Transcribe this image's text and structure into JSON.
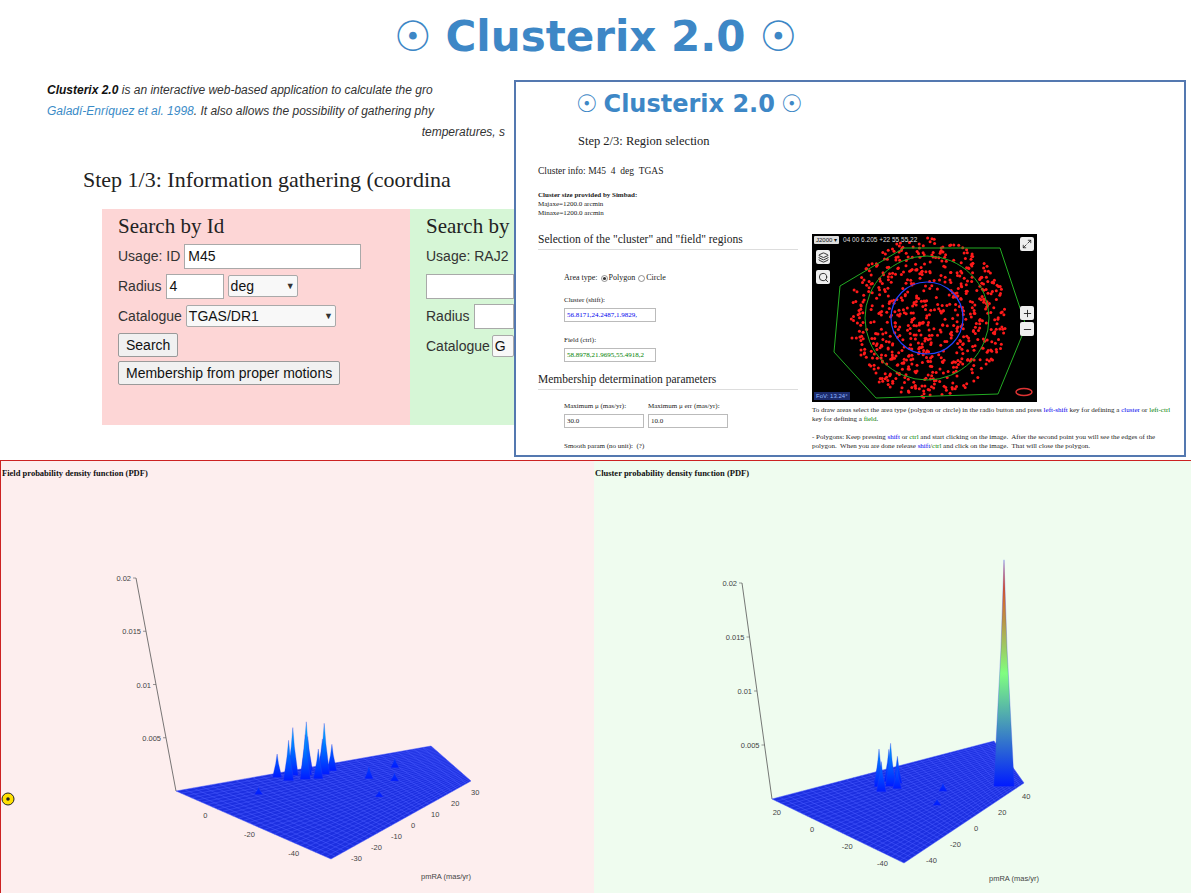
{
  "page": {
    "symbol": "☉",
    "title": "Clusterix 2.0",
    "intro": [
      [
        {
          "text": "Clusterix 2.0",
          "kind": "bold"
        },
        {
          "text": " is an interactive web-based application to calculate the gro",
          "kind": "plain"
        }
      ],
      [
        {
          "text": "Galadí-Enríquez et al. 1998",
          "kind": "link"
        },
        {
          "text": ". It also allows the possibility of gathering phy",
          "kind": "plain"
        }
      ],
      [
        {
          "text": "temperatures, s",
          "kind": "plain"
        }
      ]
    ],
    "step": "Step 1/3: Information gathering (coordina",
    "search_by_id": {
      "title": "Search by Id",
      "usage_label": "Usage: ID",
      "id_value": "M45",
      "radius_label": "Radius",
      "radius_value": "4",
      "unit": "deg",
      "catalogue_label": "Catalogue",
      "catalogue": "TGAS/DR1",
      "arrow": "▼",
      "search_button": "Search",
      "membership_button": "Membership from proper motions"
    },
    "search_by_coordinates": {
      "title": "Search by",
      "usage_label": "Usage: RAJ2",
      "radius_label": "Radius",
      "catalogue_label": "Catalogue",
      "catalogue": "G"
    }
  },
  "region_window": {
    "symbol": "☉",
    "title": "Clusterix 2.0",
    "step": "Step 2/3: Region selection",
    "cluster_info": "Cluster info: M45  4  deg  TGAS",
    "size_heading": "Cluster size provided by Simbad:",
    "size_lines": [
      "Majaxe=1200.0 arcmin",
      "Minaxe=1200.0 arcmin"
    ],
    "selection_heading": "Selection of the \"cluster\" and \"field\" regions",
    "area_type_label": "Area type:",
    "area_types": [
      {
        "label": "Polygon",
        "selected": true
      },
      {
        "label": "Circle",
        "selected": false
      }
    ],
    "cluster_label": "Cluster (shift):",
    "cluster_value": "56.8171,24.2487,1.9829,",
    "field_label": "Field (ctrl):",
    "field_value": "58.8978,21.9695,55.4918,2",
    "membership_heading": "Membership determination parameters",
    "params": [
      {
        "label": "Maximum μ (mas/yr):",
        "value": "30.0"
      },
      {
        "label": "Maximum μ err (mas/yr):",
        "value": "10.0"
      }
    ],
    "smooth_label": "Smooth param (no unit):  (?)",
    "viewer": {
      "frame": "J2000",
      "frame_arrow": "▾",
      "coords": "04 00 6.205 +22 55 55.22",
      "fov": "FoV: 13.24°"
    },
    "help": [
      [
        {
          "text": "To draw areas select the area type (polygon or circle) in the radio button and press ",
          "color": "#222222"
        },
        {
          "text": "left-shift",
          "color": "#0000ee"
        },
        {
          "text": " key for defining a ",
          "color": "#222222"
        },
        {
          "text": "cluster",
          "color": "#0000ee"
        },
        {
          "text": " or ",
          "color": "#222222"
        },
        {
          "text": "left-ctrl",
          "color": "#008000"
        },
        {
          "text": " key for defining a ",
          "color": "#222222"
        },
        {
          "text": "field",
          "color": "#008000"
        },
        {
          "text": ".",
          "color": "#222222"
        }
      ],
      [
        {
          "text": "- Polygons: Keep pressing ",
          "color": "#222222"
        },
        {
          "text": "shift",
          "color": "#0000ee"
        },
        {
          "text": " or ",
          "color": "#222222"
        },
        {
          "text": "ctrl",
          "color": "#008000"
        },
        {
          "text": " and start clicking on the image.  After the second point you will see the edges of the polygon.  When you are done release ",
          "color": "#222222"
        },
        {
          "text": "shift",
          "color": "#0000ee"
        },
        {
          "text": "/",
          "color": "#222222"
        },
        {
          "text": "ctrl",
          "color": "#008000"
        },
        {
          "text": " and click on the image.  That will close the polygon.",
          "color": "#222222"
        }
      ]
    ]
  },
  "field_pdf": {
    "title": "Field probability density function (PDF)",
    "z_ticks": [
      "0.02",
      "0.015",
      "0.01",
      "0.005"
    ],
    "x_ticks": [
      "0",
      "-20",
      "-40"
    ],
    "y_ticks": [
      "30",
      "20",
      "10",
      "0",
      "-10",
      "-20",
      "-30"
    ],
    "x_label": "pmRA (mas/yr)",
    "points": [
      [
        10,
        -5,
        0.0045
      ],
      [
        8,
        -2,
        0.005
      ],
      [
        6,
        -8,
        0.0038
      ],
      [
        12,
        0,
        0.0032
      ],
      [
        4,
        -4,
        0.0042
      ],
      [
        9,
        3,
        0.003
      ],
      [
        2,
        -1,
        0.0028
      ],
      [
        7,
        5,
        0.0025
      ],
      [
        11,
        -9,
        0.0022
      ],
      [
        5,
        2,
        0.0048
      ],
      [
        -10,
        10,
        0.0012
      ],
      [
        -20,
        15,
        0.0008
      ],
      [
        -5,
        20,
        0.0009
      ],
      [
        0,
        -20,
        0.0007
      ],
      [
        -30,
        5,
        0.0006
      ]
    ]
  },
  "cluster_pdf": {
    "title": "Cluster probability density function (PDF)",
    "z_ticks": [
      "0.02",
      "0.015",
      "0.01",
      "0.005"
    ],
    "x_ticks": [
      "20",
      "0",
      "-20",
      "-40"
    ],
    "y_ticks": [
      "40",
      "20",
      "0",
      "-20",
      "-40"
    ],
    "x_label": "pmRA (mas/yr)",
    "points": [
      [
        10,
        -10,
        0.0035
      ],
      [
        7,
        -6,
        0.004
      ],
      [
        12,
        -4,
        0.003
      ],
      [
        5,
        -12,
        0.0028
      ],
      [
        8,
        -2,
        0.0025
      ],
      [
        14,
        -8,
        0.002
      ],
      [
        3,
        -5,
        0.0018
      ],
      [
        -15,
        10,
        0.0008
      ],
      [
        -25,
        0,
        0.0006
      ],
      [
        -40,
        38,
        0.021
      ]
    ]
  }
}
